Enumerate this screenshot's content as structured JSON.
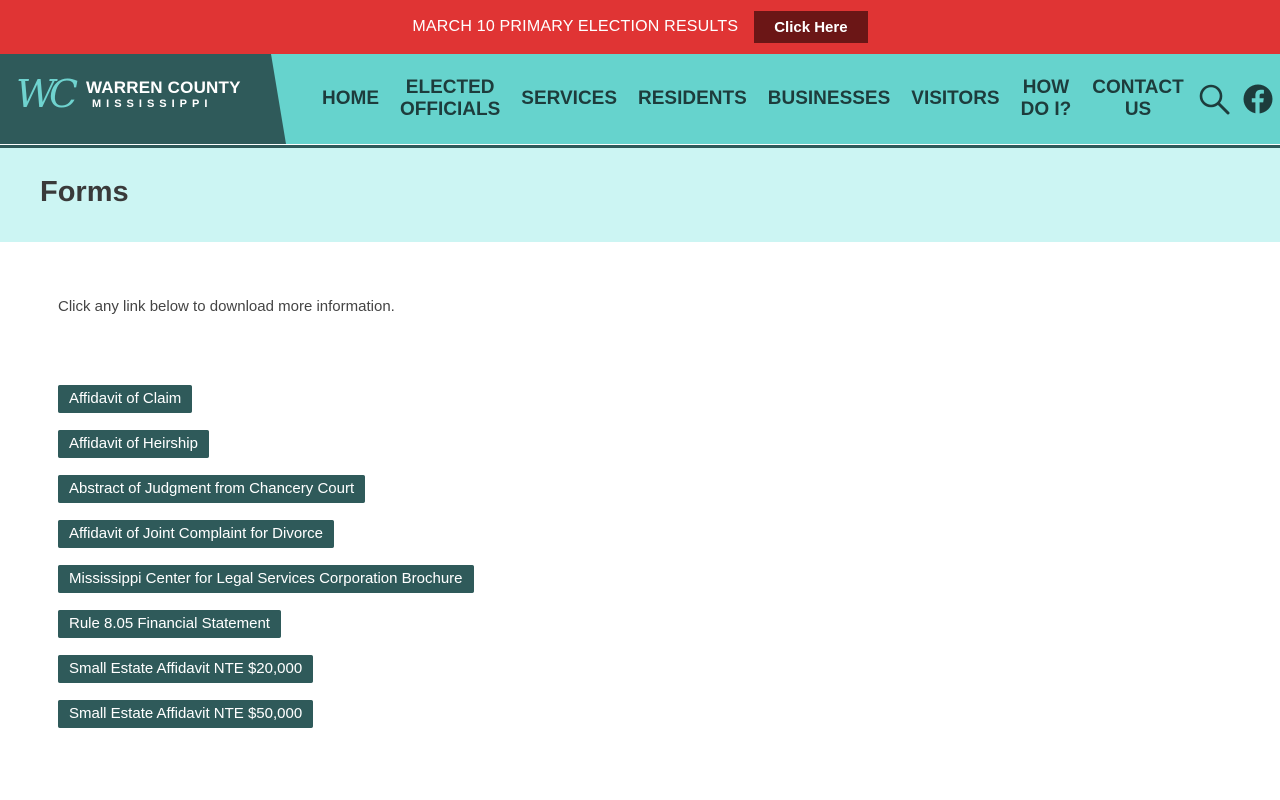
{
  "colors": {
    "alert_bg": "#e03434",
    "alert_button_bg": "#6b1616",
    "logo_bg": "#2f5a5a",
    "logo_mark": "#6fd3cf",
    "nav_bg": "#66d3cd",
    "nav_text": "#1d3c3c",
    "title_band_bg": "#ccf5f3",
    "rule": "#2f5a5a",
    "form_button_bg": "#2f5a5a"
  },
  "alert": {
    "text": "MARCH 10 PRIMARY ELECTION RESULTS",
    "button_label": "Click Here"
  },
  "logo": {
    "mark": "WC",
    "title": "WARREN COUNTY",
    "subtitle": "MISSISSIPPI"
  },
  "nav": {
    "items": [
      {
        "label": "HOME"
      },
      {
        "label": "ELECTED\nOFFICIALS"
      },
      {
        "label": "SERVICES"
      },
      {
        "label": "RESIDENTS"
      },
      {
        "label": "BUSINESSES"
      },
      {
        "label": "VISITORS"
      },
      {
        "label": "HOW\nDO I?"
      },
      {
        "label": "CONTACT\nUS"
      }
    ],
    "icons": [
      "search-icon",
      "facebook-icon"
    ]
  },
  "page": {
    "title": "Forms",
    "intro": "Click any link below to download more information."
  },
  "forms": [
    {
      "label": "Affidavit of Claim"
    },
    {
      "label": "Affidavit of Heirship"
    },
    {
      "label": "Abstract of Judgment from Chancery Court"
    },
    {
      "label": "Affidavit of Joint Complaint for Divorce"
    },
    {
      "label": "Mississippi Center for Legal Services Corporation Brochure"
    },
    {
      "label": "Rule 8.05 Financial Statement"
    },
    {
      "label": "Small Estate Affidavit NTE $20,000"
    },
    {
      "label": "Small Estate Affidavit NTE $50,000"
    }
  ]
}
